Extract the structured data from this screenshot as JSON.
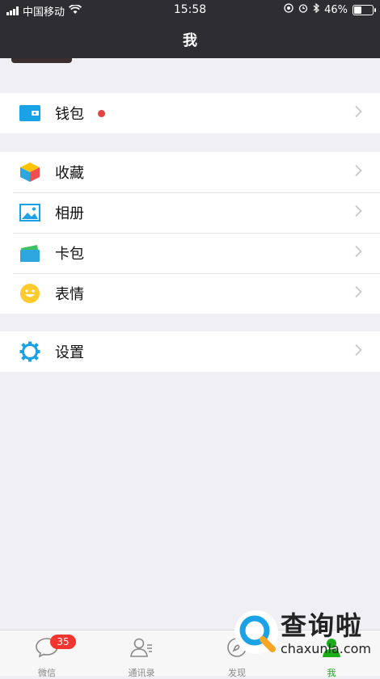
{
  "status_bar": {
    "carrier": "中国移动",
    "time": "15:58",
    "battery_percent": "46%",
    "battery_level": 0.46,
    "icons": [
      "signal-icon",
      "wifi-icon",
      "location-icon",
      "alarm-icon",
      "bluetooth-icon",
      "battery-icon"
    ]
  },
  "nav": {
    "title": "我"
  },
  "groups": [
    {
      "items": [
        {
          "label": "钱包",
          "icon": "wallet-icon",
          "has_dot": true
        }
      ]
    },
    {
      "items": [
        {
          "label": "收藏",
          "icon": "favorites-cube-icon"
        },
        {
          "label": "相册",
          "icon": "album-picture-icon"
        },
        {
          "label": "卡包",
          "icon": "card-pack-icon"
        },
        {
          "label": "表情",
          "icon": "smiley-icon"
        }
      ]
    },
    {
      "items": [
        {
          "label": "设置",
          "icon": "settings-gear-icon"
        }
      ]
    }
  ],
  "tabbar": {
    "tabs": [
      {
        "label": "微信",
        "icon": "chat-bubble-icon",
        "badge": "35"
      },
      {
        "label": "通讯录",
        "icon": "contacts-icon"
      },
      {
        "label": "发现",
        "icon": "compass-icon"
      },
      {
        "label": "我",
        "icon": "person-icon",
        "active": true
      }
    ]
  },
  "watermark": {
    "title": "查询啦",
    "site": "chaxunla.com"
  },
  "colors": {
    "active_green": "#1aad19",
    "badge_red": "#f43530",
    "nav_bg": "#2e2e32"
  }
}
